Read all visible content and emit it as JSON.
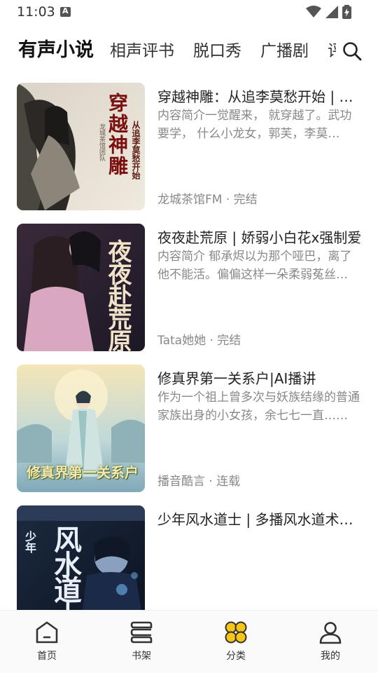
{
  "status_bar": {
    "time": "11:03"
  },
  "tabs": [
    {
      "label": "有声小说",
      "active": true
    },
    {
      "label": "相声评书"
    },
    {
      "label": "脱口秀"
    },
    {
      "label": "广播剧"
    },
    {
      "label": "评"
    }
  ],
  "items": [
    {
      "title": "穿越神雕：从追李莫愁开始 | 龙城茶馆团队",
      "desc": "内容简介一觉醒来， 就穿越了。武功要学， 什么小龙女，郭芙，李莫愁……",
      "meta": "龙城茶馆FM · 完结",
      "cover_title": "穿越神雕",
      "cover_sub": "从追李莫愁开始",
      "cover_side": "龙城茶馆团队"
    },
    {
      "title": "夜夜赴荒原 | 娇弱小白花x强制爱",
      "desc": "内容简介 郁承烬以为那个哑巴，离了他不能活。偏偏这样一朵柔弱菟丝花……",
      "meta": "Tata她她 · 完结",
      "cover_title": "夜夜赴荒原"
    },
    {
      "title": "修真界第一关系户|AI播讲",
      "desc": "作为一个祖上曾多次与妖族结缘的普通家族出身的小女孩，余七七一直……",
      "meta": "播音酷言 · 连载",
      "cover_title": "修真界第一关系户"
    },
    {
      "title": "少年风水道士 | 多播风水道术小说",
      "desc": "",
      "meta": "",
      "cover_title": "风水道士",
      "cover_side": "少年"
    }
  ],
  "bottom_nav": [
    {
      "label": "首页",
      "icon": "home-icon"
    },
    {
      "label": "书架",
      "icon": "bookshelf-icon"
    },
    {
      "label": "分类",
      "icon": "category-icon",
      "active": true
    },
    {
      "label": "我的",
      "icon": "profile-icon"
    }
  ],
  "colors": {
    "accent": "#F5C518",
    "text": "#222222",
    "secondary": "#888888"
  }
}
